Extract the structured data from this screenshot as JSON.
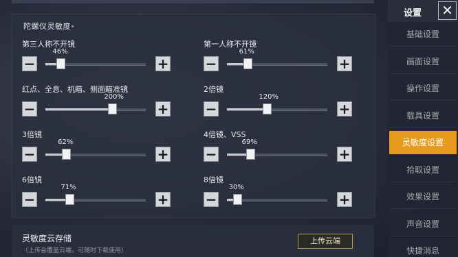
{
  "main": {
    "section_title": "陀螺仪灵敏度",
    "settings": [
      {
        "label": "第三人称不开镜",
        "value": 46,
        "value_text": "46%"
      },
      {
        "label": "第一人称不开镜",
        "value": 61,
        "value_text": "61%"
      },
      {
        "label": "红点、全息、机瞄、侧面瞄准镜",
        "value": 200,
        "value_text": "200%"
      },
      {
        "label": "2倍镜",
        "value": 120,
        "value_text": "120%"
      },
      {
        "label": "3倍镜",
        "value": 62,
        "value_text": "62%"
      },
      {
        "label": "4倍镜、VSS",
        "value": 69,
        "value_text": "69%"
      },
      {
        "label": "6倍镜",
        "value": 71,
        "value_text": "71%"
      },
      {
        "label": "8倍镜",
        "value": 30,
        "value_text": "30%"
      }
    ],
    "slider_range": [
      0,
      300
    ],
    "minus_glyph": "−",
    "plus_glyph": "+"
  },
  "cloud": {
    "title": "灵敏度云存储",
    "subtitle": "（上传会覆盖云端，可随时下载使用）",
    "upload_label": "上传云端"
  },
  "sidebar": {
    "title": "设置",
    "close_glyph": "✕",
    "items": [
      {
        "label": "基础设置",
        "active": false
      },
      {
        "label": "画面设置",
        "active": false
      },
      {
        "label": "操作设置",
        "active": false
      },
      {
        "label": "载具设置",
        "active": false
      },
      {
        "label": "灵敏度设置",
        "active": true
      },
      {
        "label": "拾取设置",
        "active": false
      },
      {
        "label": "效果设置",
        "active": false
      },
      {
        "label": "声音设置",
        "active": false
      },
      {
        "label": "快捷消息",
        "active": false
      }
    ]
  },
  "colors": {
    "accent": "#e69a1e",
    "upload_border": "#b59a4a"
  }
}
